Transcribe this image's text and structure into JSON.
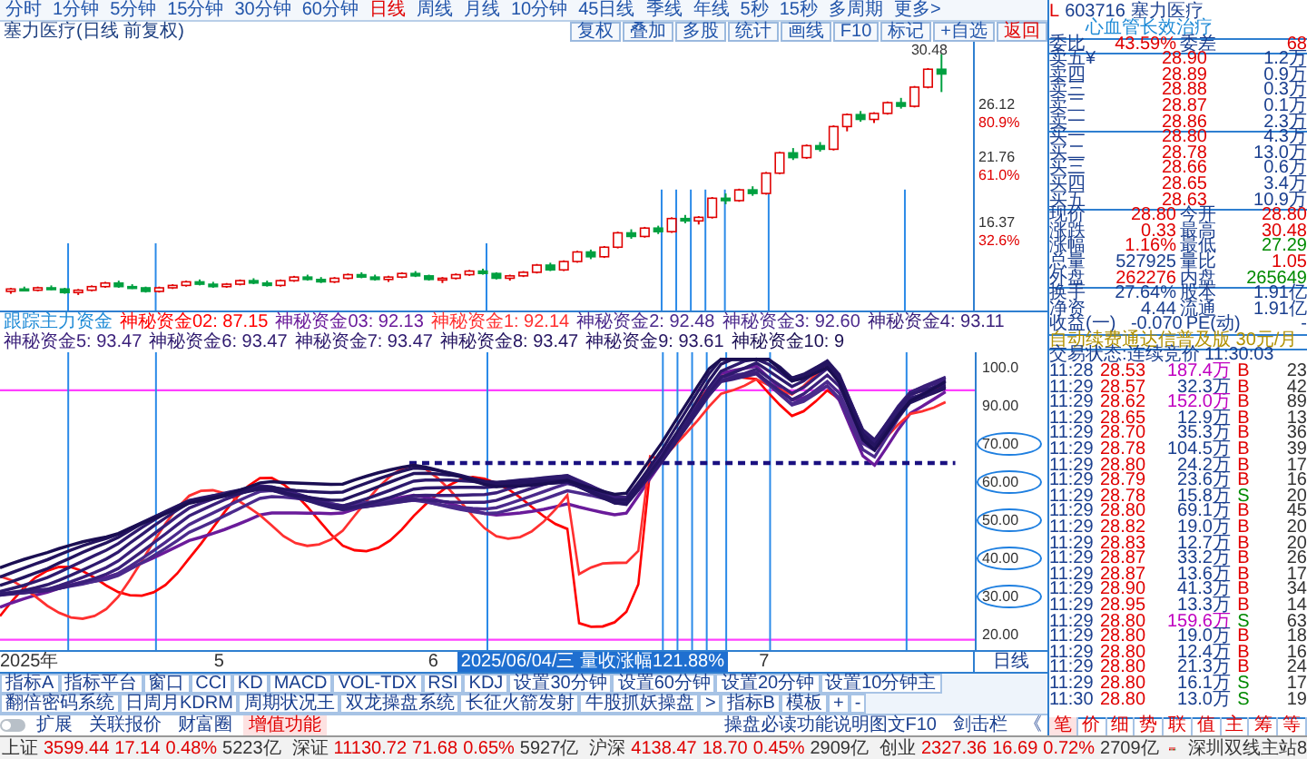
{
  "toolbar": {
    "periods": [
      {
        "label": "分时",
        "selected": false
      },
      {
        "label": "1分钟",
        "selected": false
      },
      {
        "label": "5分钟",
        "selected": false
      },
      {
        "label": "15分钟",
        "selected": false
      },
      {
        "label": "30分钟",
        "selected": false
      },
      {
        "label": "60分钟",
        "selected": false
      },
      {
        "label": "日线",
        "selected": true
      },
      {
        "label": "周线",
        "selected": false
      },
      {
        "label": "月线",
        "selected": false
      },
      {
        "label": "10分钟",
        "selected": false
      },
      {
        "label": "45日线",
        "selected": false
      },
      {
        "label": "季线",
        "selected": false
      },
      {
        "label": "年线",
        "selected": false
      },
      {
        "label": "5秒",
        "selected": false
      },
      {
        "label": "15秒",
        "selected": false
      },
      {
        "label": "多周期",
        "selected": false
      },
      {
        "label": "更多>",
        "selected": false
      }
    ]
  },
  "chart": {
    "title": "塞力医疗(日线 前复权)",
    "buttons": [
      "复权",
      "叠加",
      "多股",
      "统计",
      "画线",
      "F10",
      "标记",
      "+自选",
      "返回"
    ],
    "high_label": "30.48",
    "pct_labels": [
      "80.9%",
      "61.0%",
      "32.6%"
    ],
    "chart_data": {
      "type": "candlestick",
      "ylim": [
        9,
        31.5
      ],
      "yticks": [
        {
          "value": 26.12,
          "label": "26.12"
        },
        {
          "value": 21.76,
          "label": "21.76"
        },
        {
          "value": 16.37,
          "label": "16.37"
        }
      ],
      "ohlc": [
        [
          10.6,
          10.9,
          10.4,
          10.8
        ],
        [
          10.8,
          11.0,
          10.6,
          10.7
        ],
        [
          10.7,
          11.0,
          10.6,
          10.9
        ],
        [
          10.9,
          11.1,
          10.7,
          10.8
        ],
        [
          10.8,
          10.9,
          10.4,
          10.5
        ],
        [
          10.5,
          10.8,
          10.3,
          10.7
        ],
        [
          10.7,
          11.1,
          10.6,
          11.0
        ],
        [
          11.0,
          11.4,
          10.9,
          11.3
        ],
        [
          11.3,
          11.5,
          10.9,
          11.0
        ],
        [
          11.0,
          11.2,
          10.8,
          10.9
        ],
        [
          10.9,
          11.0,
          10.5,
          10.6
        ],
        [
          10.6,
          11.0,
          10.5,
          10.9
        ],
        [
          10.9,
          11.2,
          10.8,
          11.1
        ],
        [
          11.1,
          11.5,
          11.0,
          11.4
        ],
        [
          11.4,
          11.6,
          11.1,
          11.2
        ],
        [
          11.2,
          11.4,
          10.9,
          11.0
        ],
        [
          11.0,
          11.3,
          10.9,
          11.2
        ],
        [
          11.2,
          11.6,
          11.1,
          11.5
        ],
        [
          11.5,
          11.7,
          11.2,
          11.3
        ],
        [
          11.3,
          11.5,
          11.0,
          11.1
        ],
        [
          11.1,
          11.6,
          11.0,
          11.5
        ],
        [
          11.5,
          11.9,
          11.4,
          11.8
        ],
        [
          11.8,
          12.0,
          11.5,
          11.6
        ],
        [
          11.6,
          11.8,
          11.3,
          11.4
        ],
        [
          11.4,
          11.8,
          11.3,
          11.7
        ],
        [
          11.7,
          12.1,
          11.6,
          12.0
        ],
        [
          12.0,
          12.2,
          11.7,
          11.8
        ],
        [
          11.8,
          12.0,
          11.5,
          11.6
        ],
        [
          11.6,
          11.9,
          11.4,
          11.8
        ],
        [
          11.8,
          12.2,
          11.7,
          12.1
        ],
        [
          12.1,
          12.3,
          11.8,
          11.9
        ],
        [
          11.9,
          12.0,
          11.5,
          11.6
        ],
        [
          11.6,
          11.8,
          11.3,
          11.7
        ],
        [
          11.7,
          12.1,
          11.6,
          12.0
        ],
        [
          12.0,
          12.4,
          11.9,
          12.3
        ],
        [
          12.3,
          12.5,
          12.0,
          12.1
        ],
        [
          12.1,
          12.2,
          11.6,
          11.7
        ],
        [
          11.7,
          12.0,
          11.5,
          11.9
        ],
        [
          11.9,
          12.3,
          11.8,
          12.2
        ],
        [
          12.2,
          12.9,
          12.1,
          12.8
        ],
        [
          12.8,
          13.0,
          12.3,
          12.4
        ],
        [
          12.4,
          13.2,
          12.3,
          13.1
        ],
        [
          13.1,
          14.0,
          13.0,
          13.9
        ],
        [
          13.9,
          14.1,
          13.3,
          13.5
        ],
        [
          13.5,
          14.4,
          13.4,
          14.3
        ],
        [
          14.3,
          15.6,
          14.2,
          15.5
        ],
        [
          15.5,
          15.8,
          15.0,
          15.2
        ],
        [
          15.2,
          16.0,
          15.1,
          15.9
        ],
        [
          15.9,
          16.1,
          15.4,
          15.6
        ],
        [
          15.6,
          16.8,
          15.5,
          16.7
        ],
        [
          16.7,
          17.0,
          16.3,
          16.5
        ],
        [
          16.5,
          16.9,
          16.2,
          16.8
        ],
        [
          16.8,
          18.5,
          16.7,
          18.4
        ],
        [
          18.4,
          18.8,
          17.9,
          18.2
        ],
        [
          18.2,
          19.2,
          18.1,
          19.1
        ],
        [
          19.1,
          19.4,
          18.6,
          18.8
        ],
        [
          18.8,
          20.6,
          18.7,
          20.5
        ],
        [
          20.5,
          22.3,
          20.4,
          22.2
        ],
        [
          22.2,
          22.6,
          21.6,
          21.8
        ],
        [
          21.8,
          22.9,
          21.7,
          22.8
        ],
        [
          22.8,
          23.1,
          22.3,
          22.5
        ],
        [
          22.5,
          24.5,
          22.4,
          24.4
        ],
        [
          24.4,
          25.5,
          24.0,
          25.4
        ],
        [
          25.4,
          25.7,
          24.8,
          25.0
        ],
        [
          25.0,
          25.6,
          24.7,
          25.5
        ],
        [
          25.5,
          26.5,
          25.4,
          26.4
        ],
        [
          26.4,
          26.8,
          25.9,
          26.1
        ],
        [
          26.1,
          27.8,
          26.0,
          27.7
        ],
        [
          27.7,
          29.3,
          27.6,
          29.2
        ],
        [
          29.2,
          30.48,
          27.29,
          28.8
        ]
      ]
    }
  },
  "indicator": {
    "title": "跟踪主力资金",
    "series": [
      {
        "label": "神秘资金02: 87.15",
        "color": "#ff0000"
      },
      {
        "label": "神秘资金03: 92.13",
        "color": "#6a1b9a"
      },
      {
        "label": "神秘资金1: 92.14",
        "color": "#ff3030"
      },
      {
        "label": "神秘资金2: 92.48",
        "color": "#4b2a8c"
      },
      {
        "label": "神秘资金3: 92.60",
        "color": "#4b2a8c"
      },
      {
        "label": "神秘资金4: 93.11",
        "color": "#3a1f7a"
      },
      {
        "label": "神秘资金5: 93.47",
        "color": "#3a1f7a"
      },
      {
        "label": "神秘资金6: 93.47",
        "color": "#2e1a6e"
      },
      {
        "label": "神秘资金7: 93.47",
        "color": "#2e1a6e"
      },
      {
        "label": "神秘资金8: 93.47",
        "color": "#241460"
      },
      {
        "label": "神秘资金9: 93.61",
        "color": "#241460"
      },
      {
        "label": "神秘资金10: 9",
        "color": "#1a0e52"
      }
    ],
    "axis": [
      {
        "label": "100.0",
        "circled": false
      },
      {
        "label": "90.00",
        "circled": false
      },
      {
        "label": "70.00",
        "circled": true
      },
      {
        "label": "60.00",
        "circled": true
      },
      {
        "label": "50.00",
        "circled": true
      },
      {
        "label": "40.00",
        "circled": true
      },
      {
        "label": "30.00",
        "circled": true
      },
      {
        "label": "20.00",
        "circled": false
      }
    ]
  },
  "date_axis": {
    "labels": [
      {
        "label": "2025年",
        "highlight": false
      },
      {
        "label": "5",
        "highlight": false
      },
      {
        "label": "6",
        "highlight": false
      },
      {
        "label": "2025/06/04/三 量收涨幅121.88%",
        "highlight": true
      },
      {
        "label": "7",
        "highlight": false
      }
    ],
    "period": "日线"
  },
  "indicator_tabs": [
    "指标A",
    "指标平台",
    "窗口",
    "CCI",
    "KD",
    "MACD",
    "VOL-TDX",
    "RSI",
    "KDJ",
    "设置30分钟",
    "设置60分钟",
    "设置20分钟",
    "设置10分钟主",
    "翻倍密码系统",
    "日周月KDRM",
    "周期状况王",
    "双龙操盘系统",
    "长征火箭发射",
    "牛股抓妖操盘",
    ">",
    "指标B",
    "模板",
    "+",
    "-"
  ],
  "extra_toggle": {
    "on": false
  },
  "extra_tabs": [
    {
      "label": "扩展",
      "selected": false
    },
    {
      "label": "关联报价",
      "selected": false
    },
    {
      "label": "财富圈",
      "selected": false
    },
    {
      "label": "增值功能",
      "selected": true
    }
  ],
  "extra_right": [
    "操盘必读功能说明图文F10",
    "剑击栏",
    "《"
  ],
  "status_bar": {
    "indices": [
      {
        "name": "上证",
        "value": "3599.44",
        "change": "17.14",
        "pct": "0.48%",
        "amount": "5223亿"
      },
      {
        "name": "深证",
        "value": "11130.72",
        "change": "71.68",
        "pct": "0.65%",
        "amount": "5927亿"
      },
      {
        "name": "沪深",
        "value": "4138.47",
        "change": "18.70",
        "pct": "0.45%",
        "amount": "2909亿"
      },
      {
        "name": "创业",
        "value": "2327.36",
        "change": "16.69",
        "pct": "0.72%",
        "amount": "2709亿"
      }
    ],
    "server": "深圳双线主站8"
  },
  "quote": {
    "flag": "L",
    "code": "603716",
    "name": "塞力医疗",
    "tag": "心血管长效治疗",
    "ratio": [
      {
        "label": "委比",
        "value": "43.59%",
        "color": "#e00000"
      },
      {
        "label": "委差",
        "value": "68",
        "color": "#e00000"
      }
    ],
    "asks": [
      {
        "label": "卖五¥",
        "price": "28.90",
        "volume": "1.2万"
      },
      {
        "label": "卖四",
        "price": "28.89",
        "volume": "0.9万"
      },
      {
        "label": "卖三",
        "price": "28.88",
        "volume": "0.3万"
      },
      {
        "label": "卖二",
        "price": "28.87",
        "volume": "0.1万"
      },
      {
        "label": "卖一",
        "price": "28.86",
        "volume": "2.3万"
      }
    ],
    "bids": [
      {
        "label": "买一",
        "price": "28.80",
        "volume": "4.3万"
      },
      {
        "label": "买二",
        "price": "28.78",
        "volume": "13.0万"
      },
      {
        "label": "买三",
        "price": "28.66",
        "volume": "0.6万"
      },
      {
        "label": "买四",
        "price": "28.65",
        "volume": "3.4万"
      },
      {
        "label": "买五",
        "price": "28.63",
        "volume": "10.9万"
      }
    ],
    "stats": [
      [
        {
          "label": "现价",
          "value": "28.80",
          "color": "#e00000"
        },
        {
          "label": "今开",
          "value": "28.80",
          "color": "#e00000"
        }
      ],
      [
        {
          "label": "涨跌",
          "value": "0.33",
          "color": "#e00000"
        },
        {
          "label": "最高",
          "value": "30.48",
          "color": "#e00000"
        }
      ],
      [
        {
          "label": "涨幅",
          "value": "1.16%",
          "color": "#e00000"
        },
        {
          "label": "最低",
          "value": "27.29",
          "color": "#008a00"
        }
      ],
      [
        {
          "label": "总量",
          "value": "527925",
          "color": "#1a3f8f"
        },
        {
          "label": "量比",
          "value": "1.05",
          "color": "#e00000"
        }
      ],
      [
        {
          "label": "外盘",
          "value": "262276",
          "color": "#e00000"
        },
        {
          "label": "内盘",
          "value": "265649",
          "color": "#008a00"
        }
      ],
      [
        {
          "label": "换手",
          "value": "27.64%",
          "color": "#1a3f8f"
        },
        {
          "label": "股本",
          "value": "1.91亿",
          "color": "#1a3f8f"
        }
      ],
      [
        {
          "label": "净资",
          "value": "4.44",
          "color": "#1a3f8f"
        },
        {
          "label": "流通",
          "value": "1.91亿",
          "color": "#1a3f8f"
        }
      ],
      [
        {
          "label": "收益(一)",
          "value": "-0.070",
          "color": "#1a3f8f"
        },
        {
          "label": "PE(动)",
          "value": "-",
          "color": "#1a3f8f"
        }
      ]
    ],
    "notice": "自动续费通达信普及版 30元/月",
    "trade_status": "交易状态:连续竞价 11:30:03",
    "trades": [
      {
        "time": "11:28",
        "price": "28.53",
        "volume": "187.4万",
        "big": true,
        "side": "B",
        "column_5": "23"
      },
      {
        "time": "11:29",
        "price": "28.57",
        "volume": "32.3万",
        "big": false,
        "side": "B",
        "column_5": "42"
      },
      {
        "time": "11:29",
        "price": "28.62",
        "volume": "152.0万",
        "big": true,
        "side": "B",
        "column_5": "89"
      },
      {
        "time": "11:29",
        "price": "28.65",
        "volume": "12.9万",
        "big": false,
        "side": "B",
        "column_5": "13"
      },
      {
        "time": "11:29",
        "price": "28.70",
        "volume": "35.3万",
        "big": false,
        "side": "B",
        "column_5": "36"
      },
      {
        "time": "11:29",
        "price": "28.78",
        "volume": "104.5万",
        "big": false,
        "side": "B",
        "column_5": "39"
      },
      {
        "time": "11:29",
        "price": "28.80",
        "volume": "24.2万",
        "big": false,
        "side": "B",
        "column_5": "17"
      },
      {
        "time": "11:29",
        "price": "28.79",
        "volume": "23.6万",
        "big": false,
        "side": "B",
        "column_5": "16"
      },
      {
        "time": "11:29",
        "price": "28.78",
        "volume": "15.8万",
        "big": false,
        "side": "S",
        "column_5": "20"
      },
      {
        "time": "11:29",
        "price": "28.80",
        "volume": "69.1万",
        "big": false,
        "side": "B",
        "column_5": "45"
      },
      {
        "time": "11:29",
        "price": "28.82",
        "volume": "19.0万",
        "big": false,
        "side": "B",
        "column_5": "20"
      },
      {
        "time": "11:29",
        "price": "28.83",
        "volume": "12.7万",
        "big": false,
        "side": "B",
        "column_5": "20"
      },
      {
        "time": "11:29",
        "price": "28.87",
        "volume": "33.2万",
        "big": false,
        "side": "B",
        "column_5": "26"
      },
      {
        "time": "11:29",
        "price": "28.87",
        "volume": "13.6万",
        "big": false,
        "side": "B",
        "column_5": "17"
      },
      {
        "time": "11:29",
        "price": "28.90",
        "volume": "41.3万",
        "big": false,
        "side": "B",
        "column_5": "34"
      },
      {
        "time": "11:29",
        "price": "28.95",
        "volume": "13.3万",
        "big": false,
        "side": "B",
        "column_5": "14"
      },
      {
        "time": "11:29",
        "price": "28.80",
        "volume": "159.6万",
        "big": true,
        "side": "S",
        "column_5": "63"
      },
      {
        "time": "11:29",
        "price": "28.80",
        "volume": "19.0万",
        "big": false,
        "side": "B",
        "column_5": "18"
      },
      {
        "time": "11:29",
        "price": "28.80",
        "volume": "12.4万",
        "big": false,
        "side": "B",
        "column_5": "16"
      },
      {
        "time": "11:29",
        "price": "28.80",
        "volume": "21.3万",
        "big": false,
        "side": "B",
        "column_5": "24"
      },
      {
        "time": "11:29",
        "price": "28.80",
        "volume": "16.1万",
        "big": false,
        "side": "S",
        "column_5": "17"
      },
      {
        "time": "11:30",
        "price": "28.80",
        "volume": "13.0万",
        "big": false,
        "side": "S",
        "column_5": "19"
      }
    ],
    "tabs": [
      {
        "label": "笔",
        "selected": true
      },
      {
        "label": "价",
        "selected": false
      },
      {
        "label": "细",
        "selected": false
      },
      {
        "label": "势",
        "selected": false
      },
      {
        "label": "联",
        "selected": false
      },
      {
        "label": "值",
        "selected": false
      },
      {
        "label": "主",
        "selected": false
      },
      {
        "label": "筹",
        "selected": false
      },
      {
        "label": "等",
        "selected": false
      }
    ]
  }
}
